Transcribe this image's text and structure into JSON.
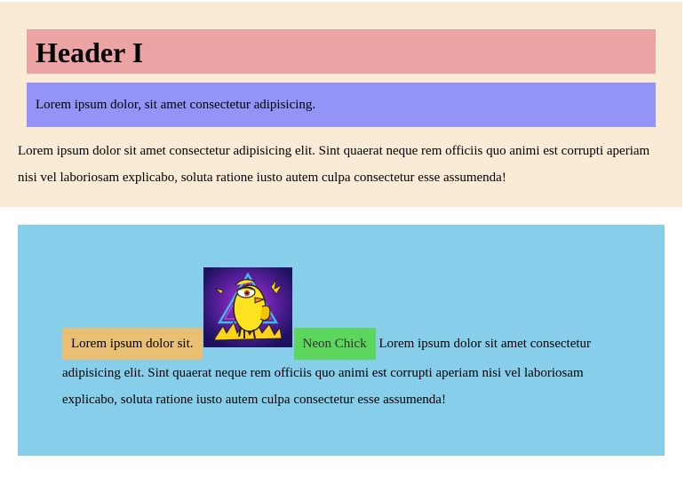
{
  "header": {
    "title": "Header I",
    "subtitle": "Lorem ipsum dolor, sit amet consectetur adipisicing."
  },
  "top_paragraph": "Lorem ipsum dolor sit amet consectetur adipisicing elit. Sint quaerat neque rem officiis quo animi est corrupti aperiam nisi vel laboriosam explicabo, soluta ratione iusto autem culpa consectetur esse assumenda!",
  "bottom": {
    "orange_label": "Lorem ipsum dolor sit.",
    "image_icon": "neon-chick-icon",
    "green_label": "Neon Chick",
    "paragraph": "Lorem ipsum dolor sit amet consectetur adipisicing elit. Sint quaerat neque rem officiis quo animi est corrupti aperiam nisi vel laboriosam explicabo, soluta ratione iusto autem culpa consectetur esse assumenda!"
  },
  "colors": {
    "top_background": "#faebd7",
    "header_background": "#eba3a3",
    "subtitle_background": "#9494f8",
    "bottom_background": "#87ceeb",
    "orange_box": "#e8bf73",
    "green_box": "#5cd65c"
  }
}
